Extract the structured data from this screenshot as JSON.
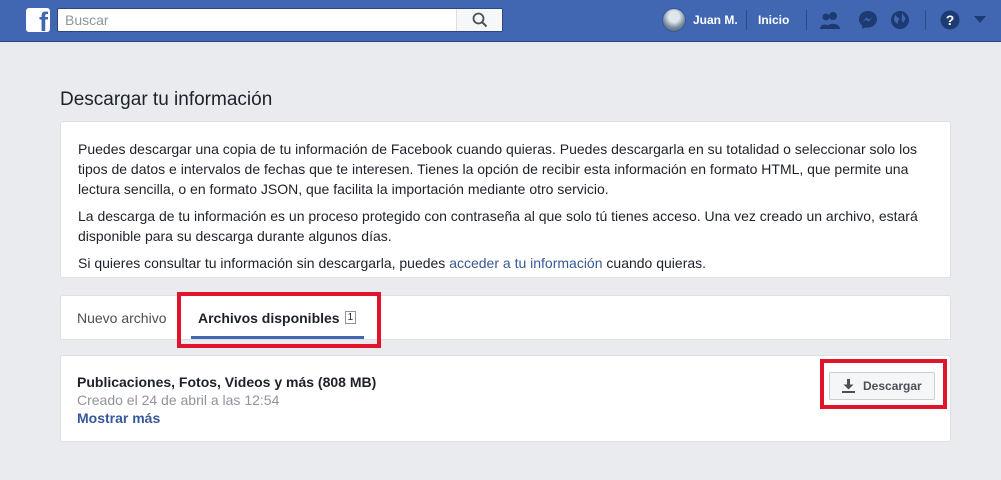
{
  "topbar": {
    "search_placeholder": "Buscar",
    "user_name": "Juan M.",
    "home_label": "Inicio",
    "icons": [
      "facebook-logo",
      "search-icon",
      "friend-requests-icon",
      "messenger-icon",
      "globe-notifications-icon",
      "help-icon",
      "caret-down-icon"
    ],
    "brand_color": "#4267b2"
  },
  "page": {
    "title": "Descargar tu información"
  },
  "info": {
    "p1": "Puedes descargar una copia de tu información de Facebook cuando quieras. Puedes descargarla en su totalidad o seleccionar solo los tipos de datos e intervalos de fechas que te interesen. Tienes la opción de recibir esta información en formato HTML, que permite una lectura sencilla, o en formato JSON, que facilita la importación mediante otro servicio.",
    "p2": "La descarga de tu información es un proceso protegido con contraseña al que solo tú tienes acceso. Una vez creado un archivo, estará disponible para su descarga durante algunos días.",
    "p3_before": "Si quieres consultar tu información sin descargarla, puedes ",
    "p3_link": "acceder a tu información",
    "p3_after": " cuando quieras."
  },
  "tabs": {
    "new_file": "Nuevo archivo",
    "available_files": "Archivos disponibles",
    "available_count": "1"
  },
  "file": {
    "title": "Publicaciones, Fotos, Videos y más (808 MB)",
    "created": "Creado el 24 de abril a las 12:54",
    "show_more": "Mostrar más",
    "download_label": "Descargar"
  },
  "highlight_color": "#e0142a"
}
